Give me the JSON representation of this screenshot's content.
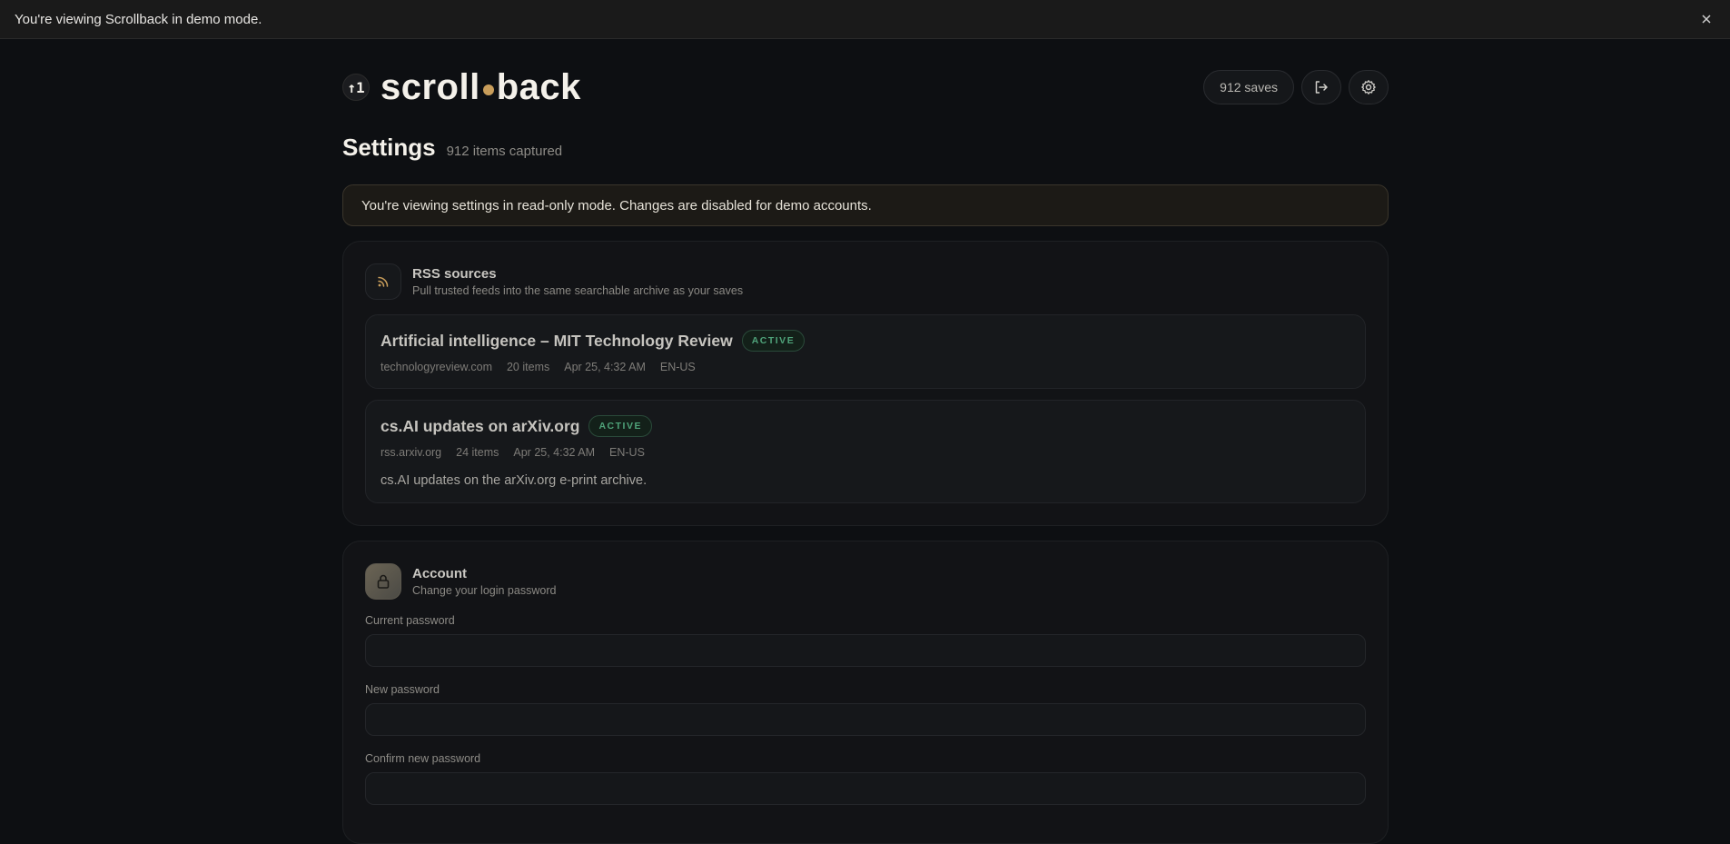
{
  "demo_banner": {
    "message": "You're viewing Scrollback in demo mode."
  },
  "brand": {
    "logo_glyph": "↑1",
    "name_left": "scroll",
    "name_right": "back"
  },
  "header": {
    "saves_label": "912 saves"
  },
  "page": {
    "title": "Settings",
    "subtitle": "912 items captured"
  },
  "readonly_notice": "You're viewing settings in read-only mode. Changes are disabled for demo accounts.",
  "rss": {
    "title": "RSS sources",
    "description": "Pull trusted feeds into the same searchable archive as your saves",
    "feeds": [
      {
        "name": "Artificial intelligence – MIT Technology Review",
        "status": "ACTIVE",
        "domain": "technologyreview.com",
        "items": "20 items",
        "updated": "Apr 25, 4:32 AM",
        "locale": "EN-US",
        "description": ""
      },
      {
        "name": "cs.AI updates on arXiv.org",
        "status": "ACTIVE",
        "domain": "rss.arxiv.org",
        "items": "24 items",
        "updated": "Apr 25, 4:32 AM",
        "locale": "EN-US",
        "description": "cs.AI updates on the arXiv.org e-print archive."
      }
    ]
  },
  "account": {
    "title": "Account",
    "description": "Change your login password",
    "current_password_label": "Current password",
    "new_password_label": "New password",
    "confirm_password_label": "Confirm new password"
  },
  "colors": {
    "accent": "#c89d5a",
    "active": "#4fa37a",
    "background": "#0d0f12"
  }
}
